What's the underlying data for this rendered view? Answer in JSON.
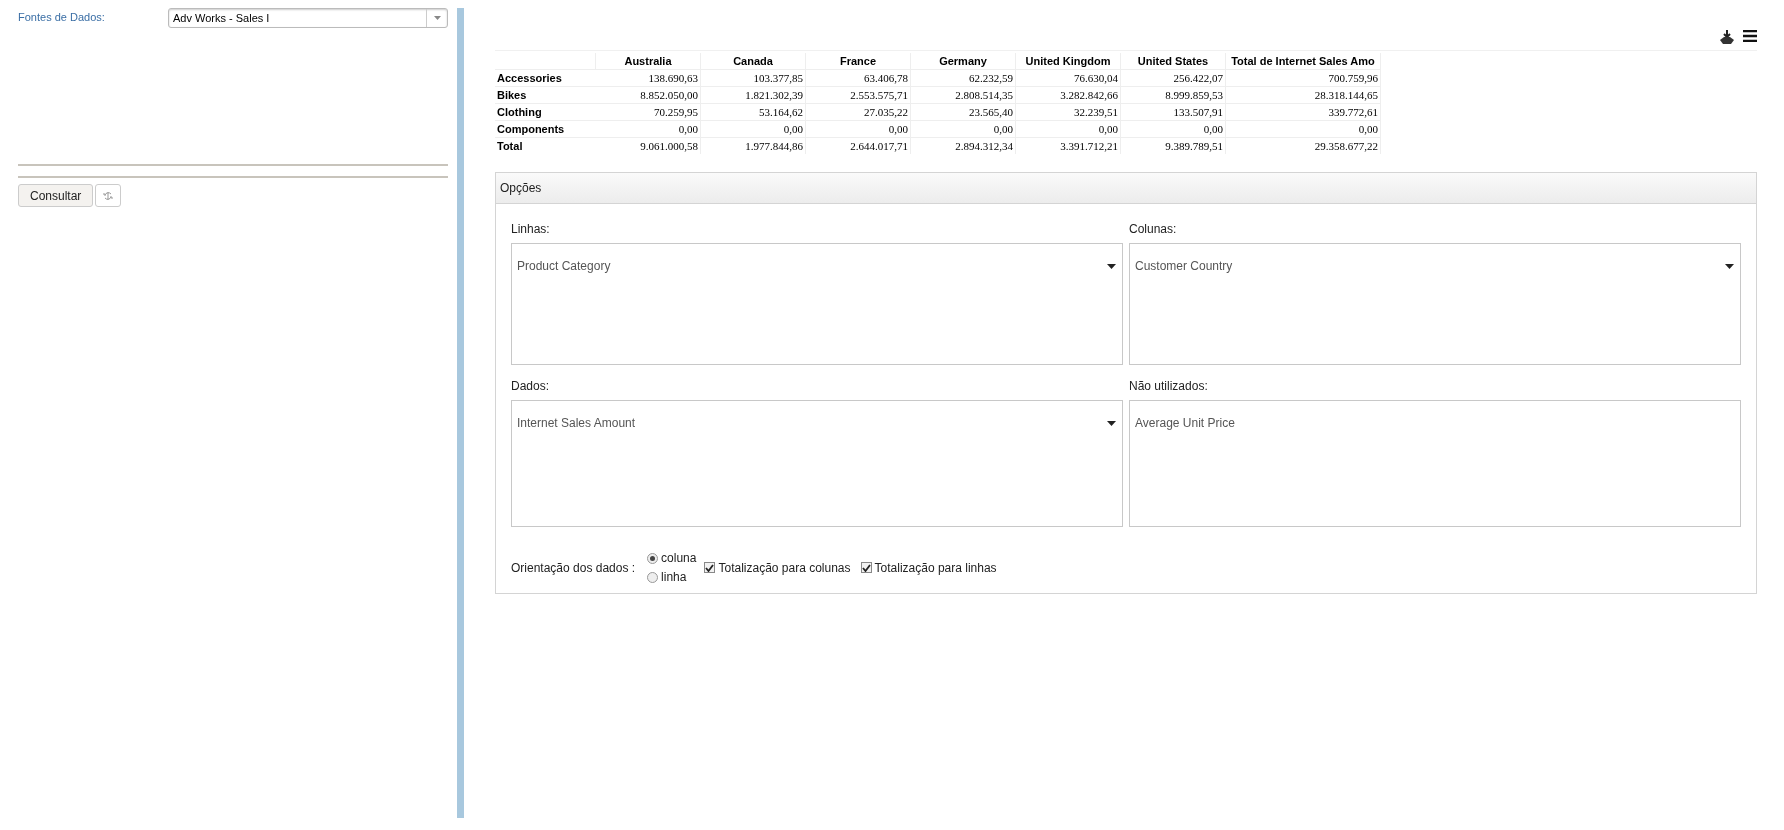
{
  "sidebar": {
    "source_label": "Fontes de Dados:",
    "source_value": "Adv Works - Sales I",
    "query_button": "Consultar"
  },
  "table": {
    "columns": [
      "Australia",
      "Canada",
      "France",
      "Germany",
      "United Kingdom",
      "United States",
      "Total de Internet Sales Amo"
    ],
    "rows": [
      {
        "label": "Accessories",
        "cells": [
          "138.690,63",
          "103.377,85",
          "63.406,78",
          "62.232,59",
          "76.630,04",
          "256.422,07",
          "700.759,96"
        ]
      },
      {
        "label": "Bikes",
        "cells": [
          "8.852.050,00",
          "1.821.302,39",
          "2.553.575,71",
          "2.808.514,35",
          "3.282.842,66",
          "8.999.859,53",
          "28.318.144,65"
        ]
      },
      {
        "label": "Clothing",
        "cells": [
          "70.259,95",
          "53.164,62",
          "27.035,22",
          "23.565,40",
          "32.239,51",
          "133.507,91",
          "339.772,61"
        ]
      },
      {
        "label": "Components",
        "cells": [
          "0,00",
          "0,00",
          "0,00",
          "0,00",
          "0,00",
          "0,00",
          "0,00"
        ]
      },
      {
        "label": "Total",
        "cells": [
          "9.061.000,58",
          "1.977.844,86",
          "2.644.017,71",
          "2.894.312,34",
          "3.391.712,21",
          "9.389.789,51",
          "29.358.677,22"
        ]
      }
    ]
  },
  "options": {
    "title": "Opções",
    "zones": [
      {
        "label": "Linhas:",
        "items": [
          {
            "name": "Product Category",
            "has_menu": true
          }
        ]
      },
      {
        "label": "Colunas:",
        "items": [
          {
            "name": "Customer Country",
            "has_menu": true
          }
        ]
      },
      {
        "label": "Dados:",
        "items": [
          {
            "name": "Internet Sales Amount",
            "has_menu": true
          }
        ]
      },
      {
        "label": "Não utilizados:",
        "items": [
          {
            "name": "Average Unit Price",
            "has_menu": false
          }
        ]
      }
    ],
    "orientation_label": "Orientação dos dados :",
    "orientation": [
      {
        "label": "coluna",
        "selected": true
      },
      {
        "label": "linha",
        "selected": false
      }
    ],
    "totals": [
      {
        "label": "Totalização para colunas",
        "checked": true
      },
      {
        "label": "Totalização para linhas",
        "checked": true
      }
    ]
  }
}
